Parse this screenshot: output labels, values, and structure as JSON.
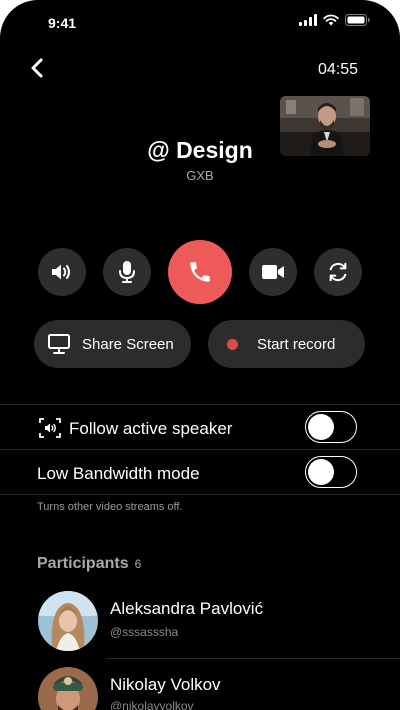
{
  "status_bar": {
    "time": "9:41"
  },
  "call": {
    "duration": "04:55",
    "title": "@ Design",
    "subtitle": "GXB"
  },
  "controls": {
    "share_screen_label": "Share Screen",
    "start_record_label": "Start record"
  },
  "settings": {
    "follow_speaker_label": "Follow active speaker",
    "follow_speaker_on": false,
    "low_bandwidth_label": "Low Bandwidth mode",
    "low_bandwidth_on": false,
    "low_bandwidth_hint": "Turns other video streams off."
  },
  "participants": {
    "heading": "Participants",
    "count": "6",
    "items": [
      {
        "name": "Aleksandra Pavlović",
        "handle": "@sssasssha"
      },
      {
        "name": "Nikolay Volkov",
        "handle": "@nikolayvolkov"
      }
    ]
  },
  "colors": {
    "background": "#000000",
    "end_call": "#ef5b5b",
    "record_dot": "#e24848",
    "control_bg": "#2e2e2e"
  }
}
